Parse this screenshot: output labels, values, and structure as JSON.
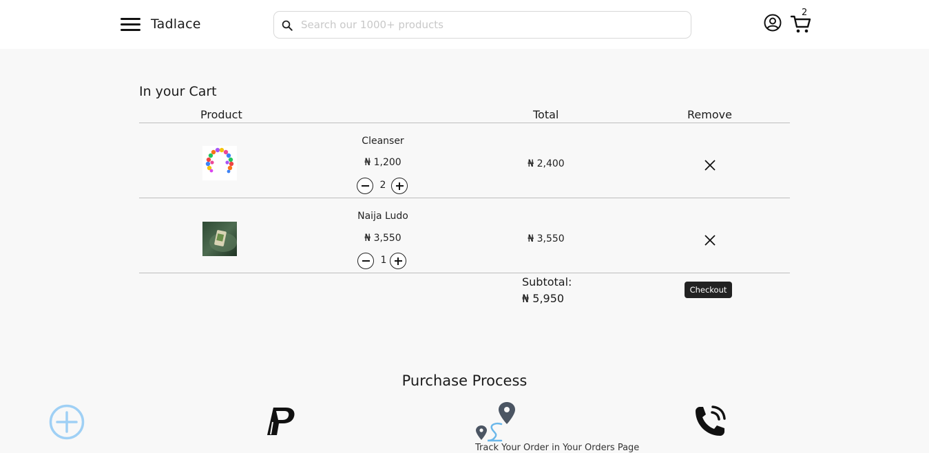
{
  "header": {
    "brand": "Tadlace",
    "search_placeholder": "Search our 1000+ products",
    "cart_count": "2",
    "icons": [
      "hamburger-menu-icon",
      "search-icon",
      "user-circle-icon",
      "shopping-cart-icon"
    ]
  },
  "cart": {
    "title": "In your Cart",
    "columns": {
      "product": "Product",
      "total": "Total",
      "remove": "Remove"
    },
    "items": [
      {
        "name": "Cleanser",
        "price": "₦ 1,200",
        "quantity": "2",
        "total": "₦ 2,400",
        "image": "balloon-garland-thumbnail"
      },
      {
        "name": "Naija Ludo",
        "price": "₦ 3,550",
        "quantity": "1",
        "total": "₦ 3,550",
        "image": "green-product-thumbnail"
      }
    ],
    "subtotal_label": "Subtotal:",
    "subtotal_value": "₦ 5,950",
    "checkout_label": "Checkout"
  },
  "purchase_process": {
    "title": "Purchase Process",
    "track_text": "Track Your Order in Your Orders Page",
    "icons": [
      "add-circle-icon",
      "paypal-icon",
      "map-route-icon",
      "phone-call-icon"
    ]
  },
  "colors": {
    "accent_fab": "#9fd0f5",
    "dark": "#222222",
    "route_blue": "#6ab7ea"
  }
}
